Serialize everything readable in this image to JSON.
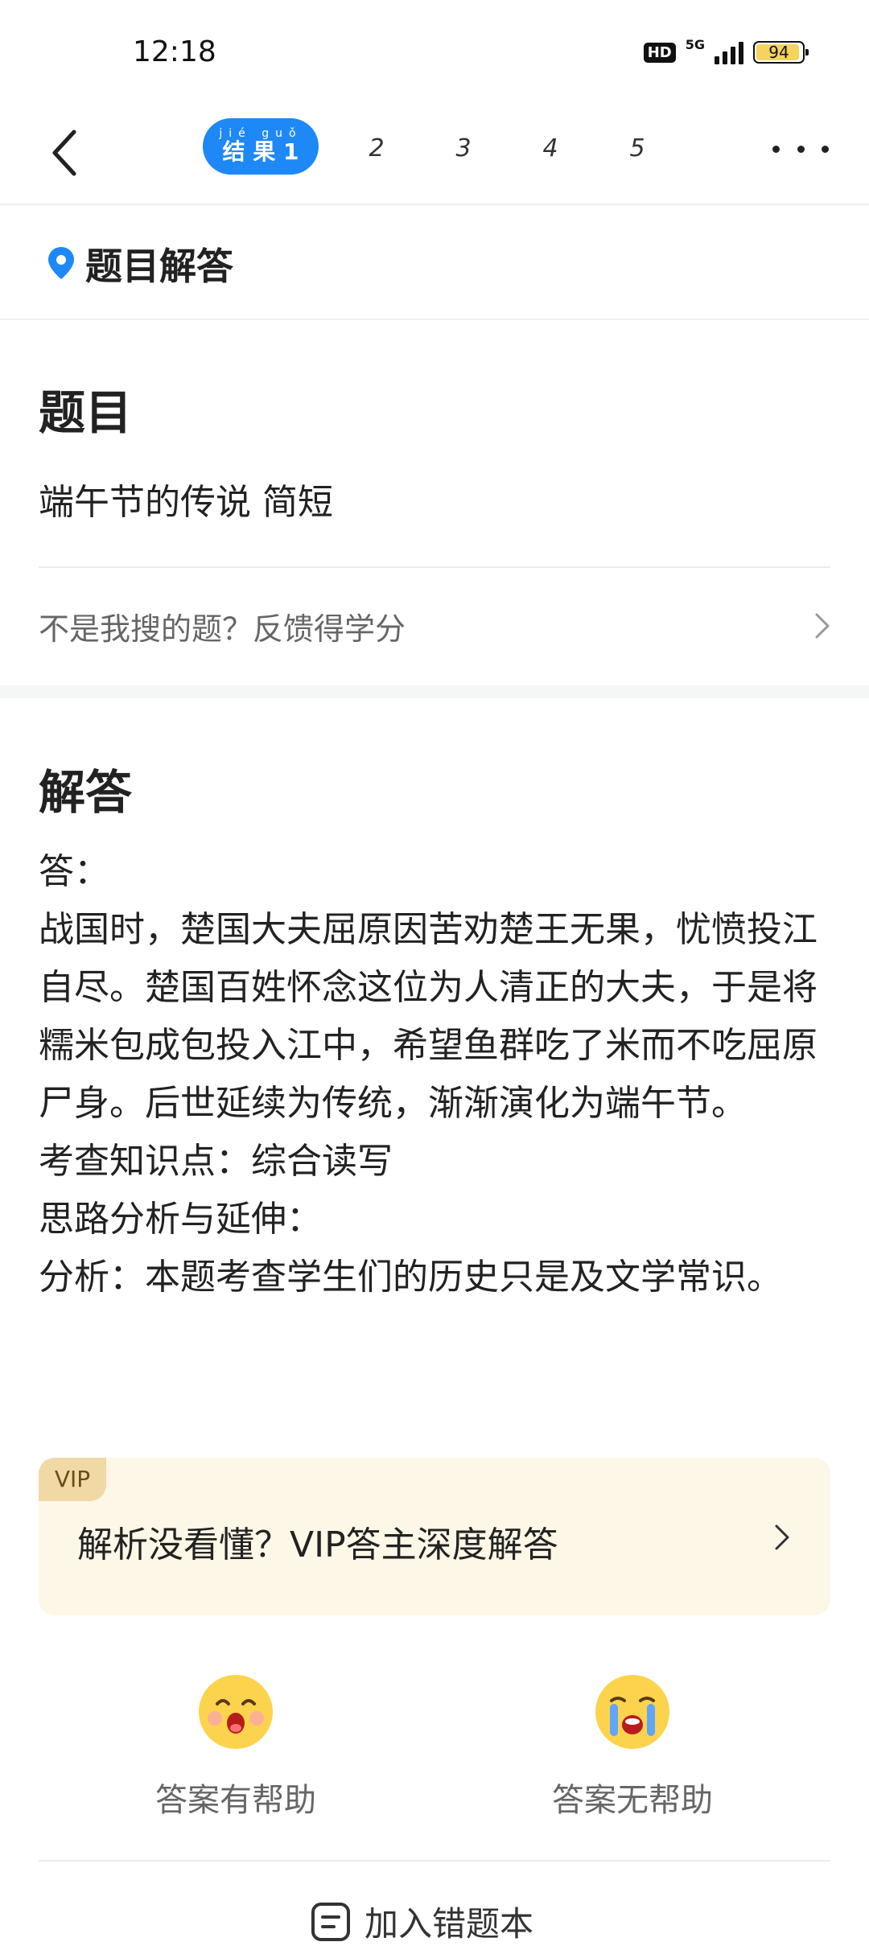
{
  "status": {
    "time": "12:18",
    "hd": "HD",
    "network": "5G",
    "battery": "94",
    "battery_level": 0.94
  },
  "nav": {
    "active_tab": {
      "pinyin": "jié guǒ",
      "label": "结 果 1"
    },
    "tabs": [
      "2",
      "3",
      "4",
      "5"
    ]
  },
  "section": {
    "title": "题目解答"
  },
  "question": {
    "heading": "题目",
    "text": "端午节的传说 简短",
    "feedback": "不是我搜的题？反馈得学分"
  },
  "answer": {
    "heading": "解答",
    "lines": [
      "答：",
      "战国时，楚国大夫屈原因苦劝楚王无果，忧愤投江自尽。楚国百姓怀念这位为人清正的大夫，于是将糯米包成包投入江中，希望鱼群吃了米而不吃屈原尸身。后世延续为传统，渐渐演化为端午节。",
      "考查知识点：综合读写",
      "思路分析与延伸：",
      "分析：本题考查学生们的历史只是及文学常识。"
    ]
  },
  "vip": {
    "tag": "VIP",
    "text": "解析没看懂？VIP答主深度解答"
  },
  "helpful": {
    "yes": "答案有帮助",
    "no": "答案无帮助"
  },
  "wrong_book": {
    "label": "加入错题本"
  },
  "colors": {
    "accent": "#1e88f7",
    "vip_bg": "#fdf7e8",
    "vip_tag": "#f1d9a6"
  }
}
